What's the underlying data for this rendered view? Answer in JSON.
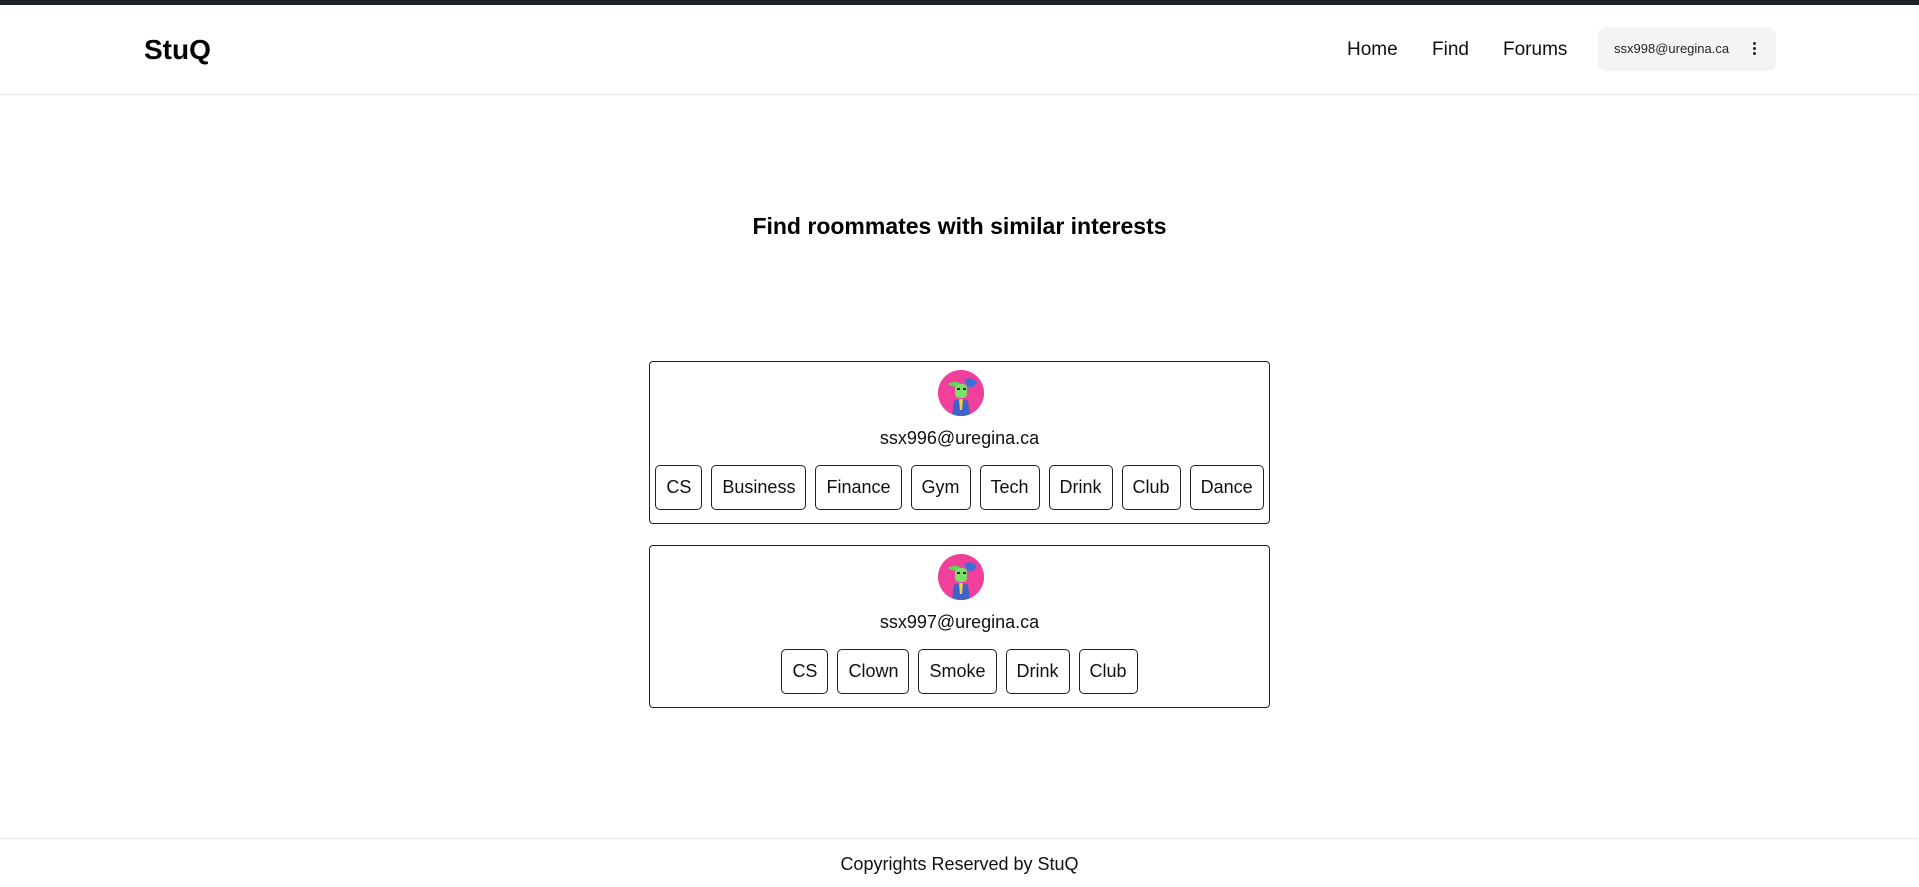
{
  "header": {
    "brand": "StuQ",
    "nav": {
      "home": "Home",
      "find": "Find",
      "forums": "Forums"
    },
    "user_email": "ssx998@uregina.ca",
    "menu_icon": "kebab-menu-icon"
  },
  "main": {
    "title": "Find roommates with similar interests",
    "matches": [
      {
        "email": "ssx996@uregina.ca",
        "avatar_icon": "user-avatar",
        "tags": [
          "CS",
          "Business",
          "Finance",
          "Gym",
          "Tech",
          "Drink",
          "Club",
          "Dance"
        ]
      },
      {
        "email": "ssx997@uregina.ca",
        "avatar_icon": "user-avatar",
        "tags": [
          "CS",
          "Clown",
          "Smoke",
          "Drink",
          "Club"
        ]
      }
    ]
  },
  "footer": {
    "text": "Copyrights Reserved by StuQ"
  },
  "colors": {
    "top_strip": "#1f2326",
    "avatar_bg": "#f0409b",
    "pill_bg": "#f3f4f6"
  }
}
